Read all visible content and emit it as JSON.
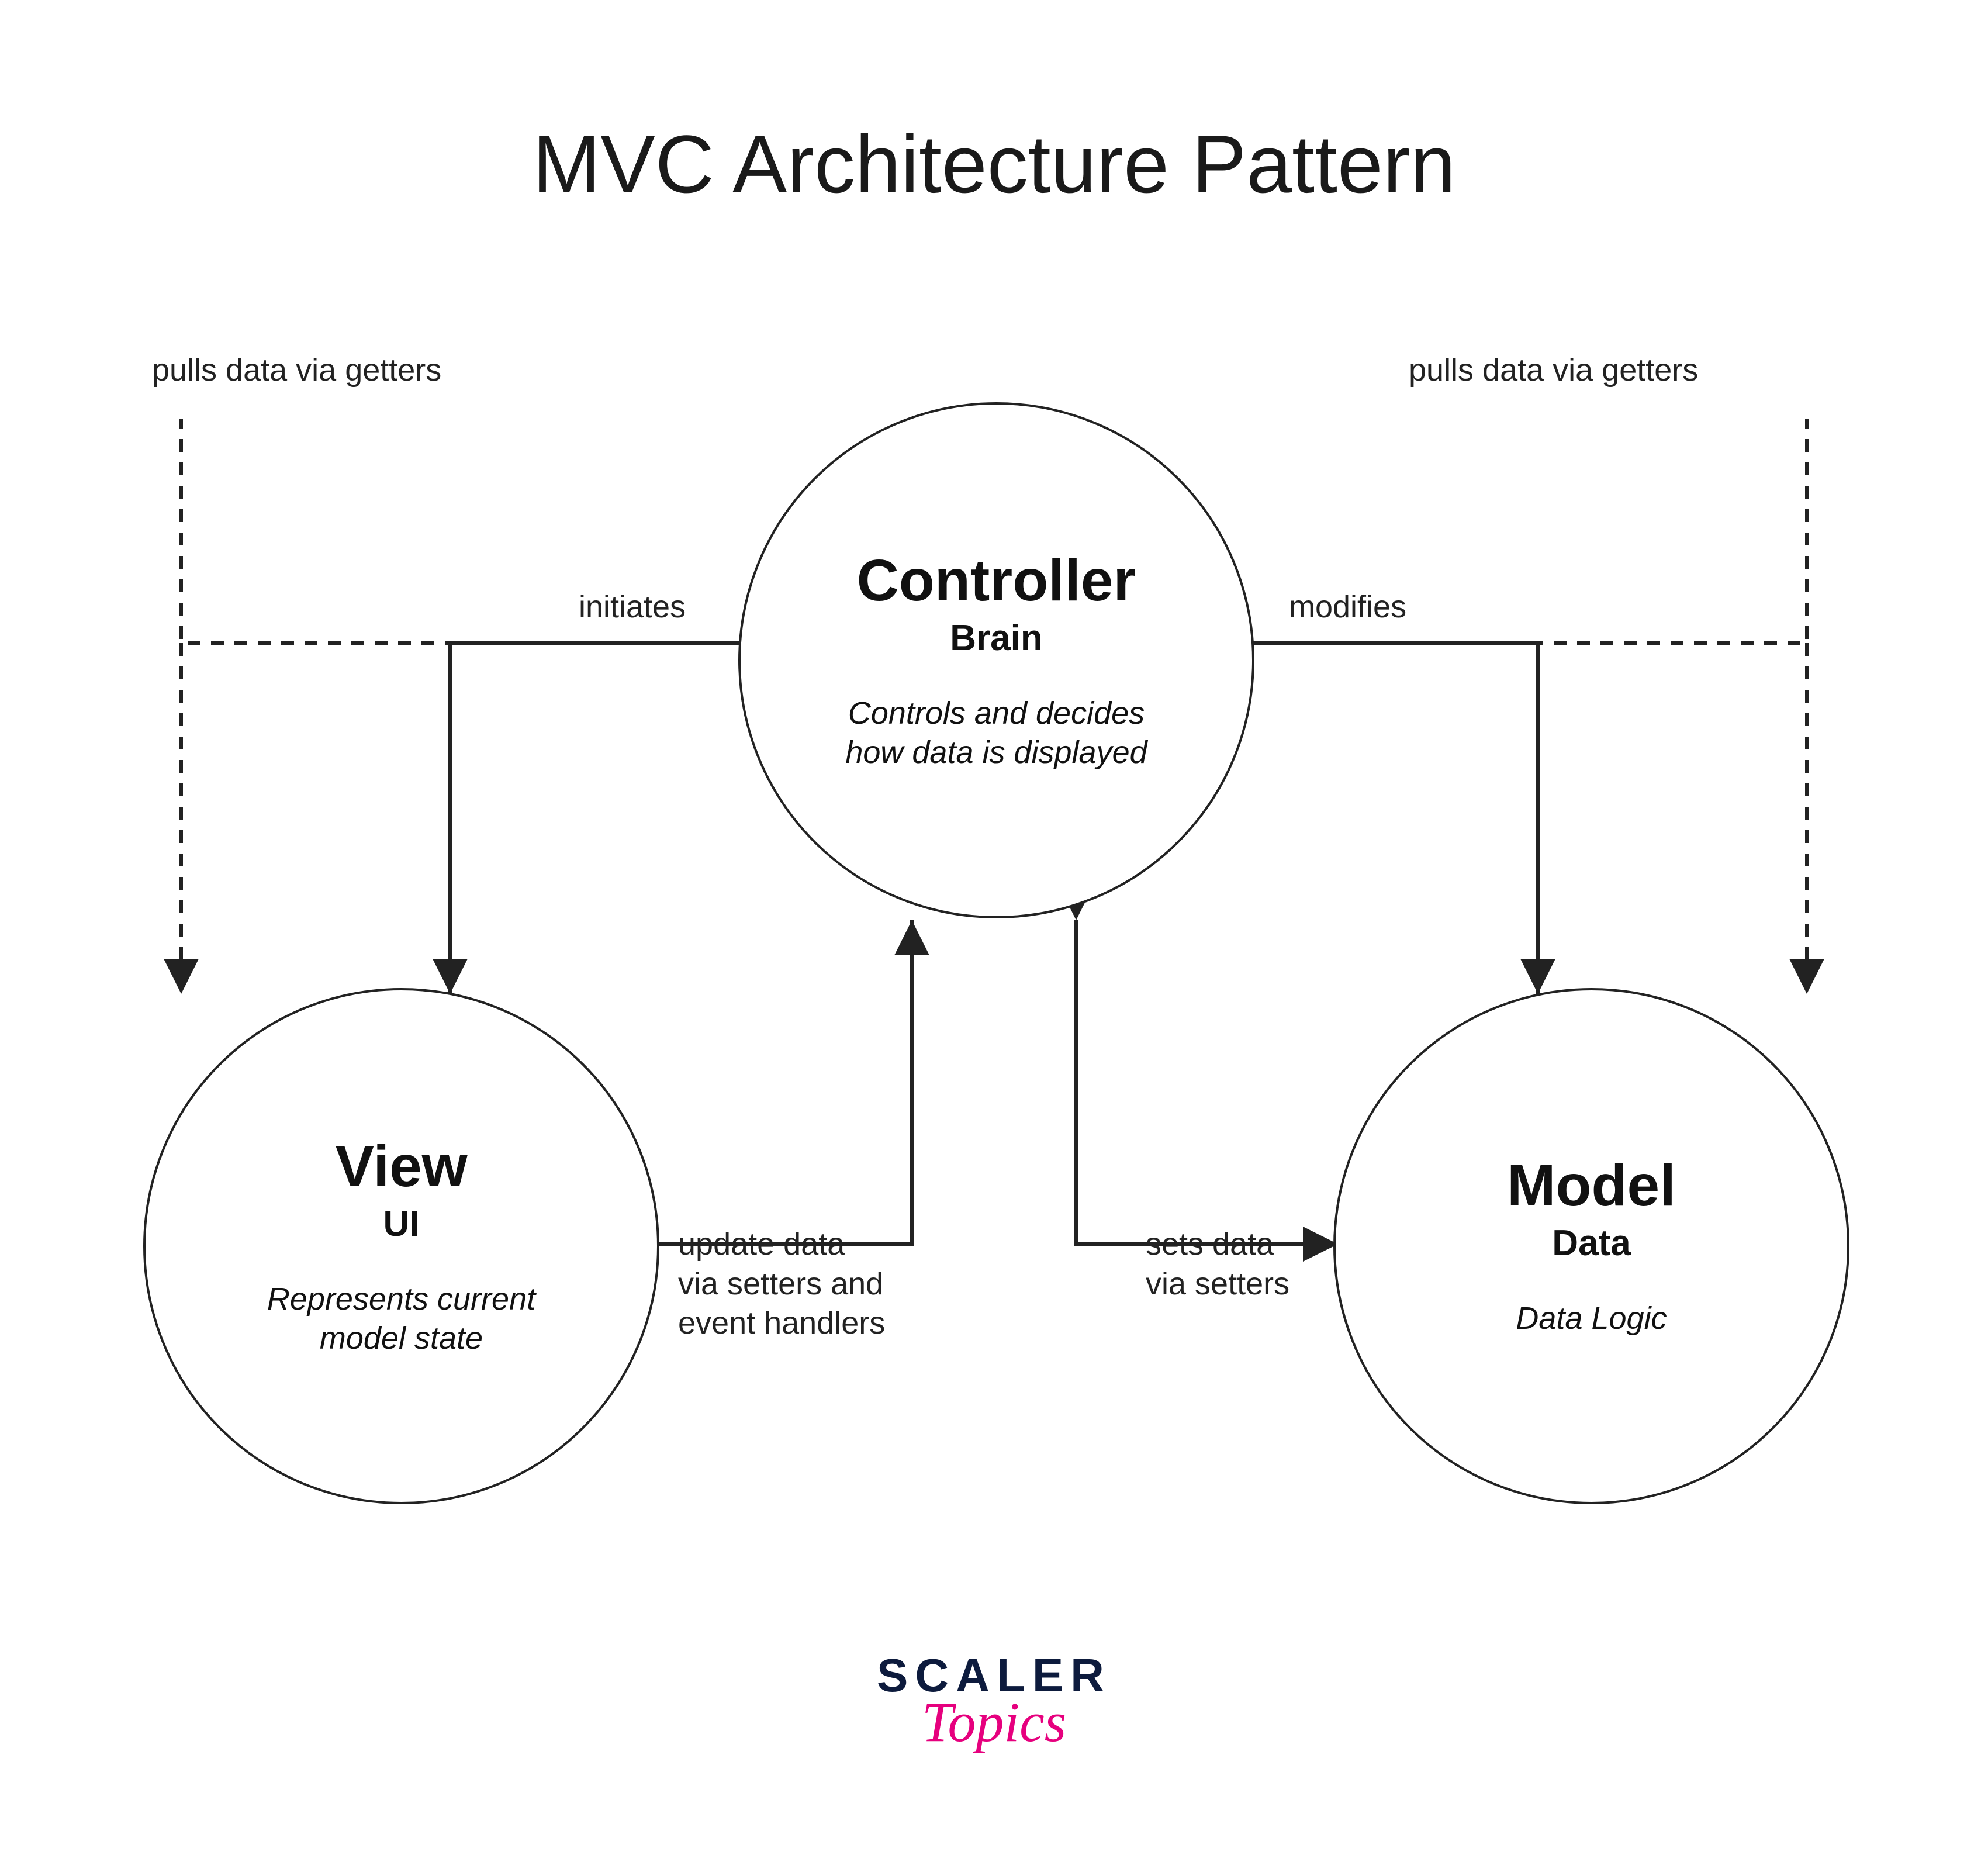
{
  "title": "MVC Architecture Pattern",
  "nodes": {
    "controller": {
      "name": "Controller",
      "role": "Brain",
      "desc": "Controls and decides\nhow data is displayed"
    },
    "view": {
      "name": "View",
      "role": "UI",
      "desc": "Represents current\nmodel state"
    },
    "model": {
      "name": "Model",
      "role": "Data",
      "desc": "Data Logic"
    }
  },
  "edges": {
    "controller_to_view": {
      "label": "initiates"
    },
    "controller_to_model": {
      "label": "modifies"
    },
    "view_to_controller": {
      "label": "update data\nvia setters and\nevent handlers"
    },
    "controller_to_model_2": {
      "label": "sets data\nvia setters"
    },
    "view_pulls": {
      "label": "pulls data via getters"
    },
    "model_pulls": {
      "label": "pulls data via getters"
    }
  },
  "brand": {
    "line1": "SCALER",
    "line2": "Topics"
  }
}
